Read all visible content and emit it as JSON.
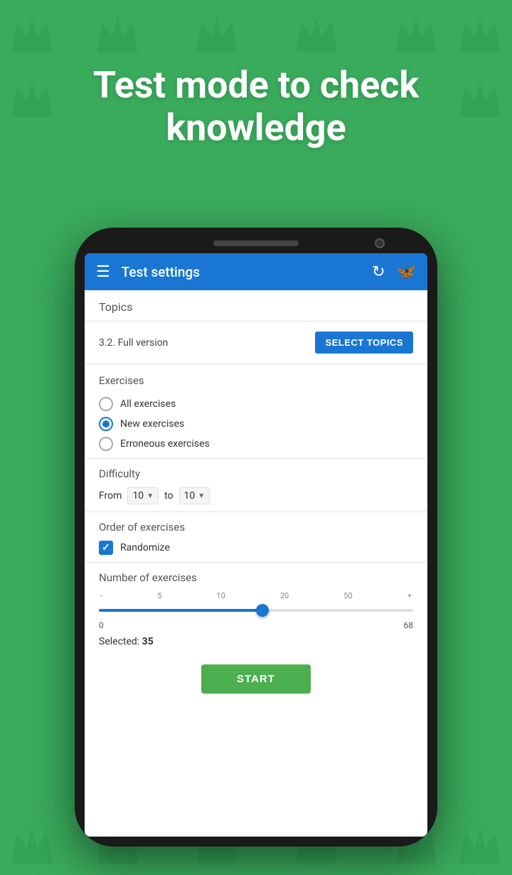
{
  "background": {
    "color": "#3aab5c"
  },
  "hero": {
    "text": "Test mode to check knowledge"
  },
  "app_bar": {
    "menu_icon": "☰",
    "title": "Test settings",
    "sync_icon": "↻",
    "butterfly_icon": "🦋"
  },
  "topics": {
    "section_label": "Topics",
    "version_text": "3.2. Full version",
    "select_button_label": "SELECT TOPICS"
  },
  "exercises": {
    "section_label": "Exercises",
    "options": [
      {
        "label": "All exercises",
        "selected": false
      },
      {
        "label": "New exercises",
        "selected": true
      },
      {
        "label": "Erroneous exercises",
        "selected": false
      }
    ]
  },
  "difficulty": {
    "section_label": "Difficulty",
    "from_label": "From",
    "from_value": "10",
    "to_label": "to",
    "to_value": "10"
  },
  "order": {
    "section_label": "Order of exercises",
    "randomize_label": "Randomize",
    "randomize_checked": true
  },
  "number": {
    "section_label": "Number of exercises",
    "slider_markers": [
      "-",
      "5",
      "10",
      "20",
      "50",
      "+"
    ],
    "min_value": "0",
    "max_value": "68",
    "slider_position_percent": 52,
    "selected_label": "Selected:",
    "selected_value": "35"
  },
  "start_button": {
    "label": "START"
  }
}
